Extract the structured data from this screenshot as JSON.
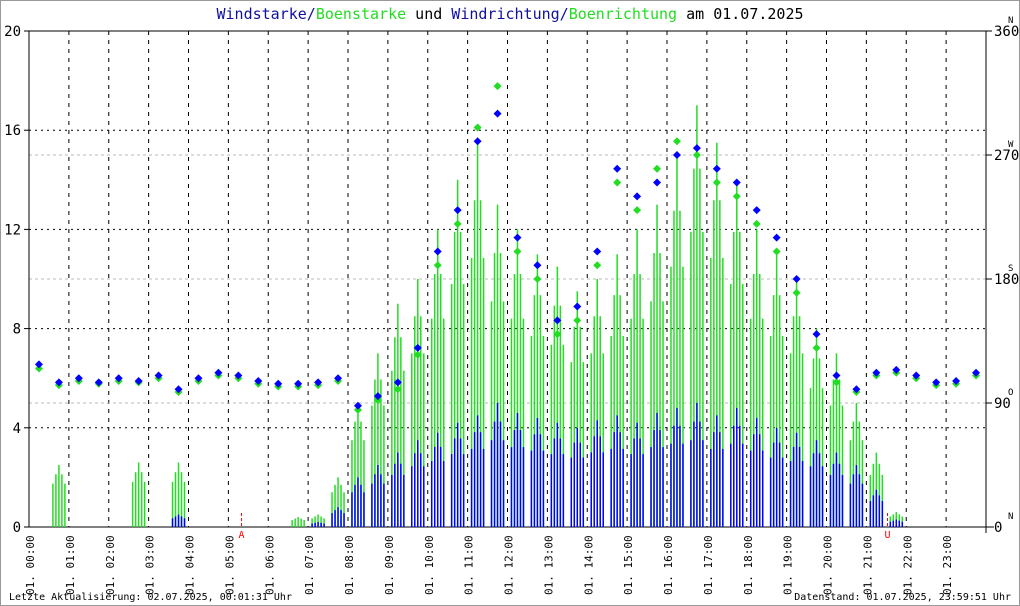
{
  "chart_data": {
    "type": "scatter",
    "title_parts": [
      {
        "text": "Windstarke",
        "color": "#1010a0"
      },
      {
        "text": "/",
        "color": "#1010a0"
      },
      {
        "text": "Boenstarke",
        "color": "#22dd22"
      },
      {
        "text": " und ",
        "color": "#000000"
      },
      {
        "text": "Windrichtung",
        "color": "#1010a0"
      },
      {
        "text": "/",
        "color": "#1010a0"
      },
      {
        "text": "Boenrichtung",
        "color": "#22dd22"
      },
      {
        "text": " am 01.07.2025",
        "color": "#000000"
      }
    ],
    "y_left": {
      "range": [
        0,
        20
      ],
      "ticks": [
        0,
        4,
        8,
        12,
        16,
        20
      ]
    },
    "y_right": {
      "range": [
        0,
        360
      ],
      "ticks": [
        0,
        90,
        180,
        270,
        360
      ],
      "compass": [
        "N",
        "O",
        "S",
        "W",
        "N"
      ]
    },
    "x_labels": [
      "01. 00:00",
      "01. 01:00",
      "01. 02:00",
      "01. 03:00",
      "01. 04:00",
      "01. 05:00",
      "01. 06:00",
      "01. 07:00",
      "01. 08:00",
      "01. 09:00",
      "01. 10:00",
      "01. 11:00",
      "01. 12:00",
      "01. 13:00",
      "01. 14:00",
      "01. 15:00",
      "01. 16:00",
      "01. 17:00",
      "01. 18:00",
      "01. 19:00",
      "01. 20:00",
      "01. 21:00",
      "01. 22:00",
      "01. 23:00"
    ],
    "markers": [
      {
        "label": "A",
        "hour": 5.33,
        "color": "#ff0000"
      },
      {
        "label": "U",
        "hour": 21.53,
        "color": "#ff0000"
      }
    ],
    "x_hours_step": 0.5,
    "series": [
      {
        "name": "Windstarke",
        "color": "#0000ff",
        "kind": "bar",
        "values": [
          0,
          0,
          0,
          0,
          0,
          0,
          0,
          0.5,
          0,
          0,
          0,
          0,
          0,
          0,
          0.2,
          0.8,
          2,
          2.5,
          3,
          3.5,
          3.8,
          4.2,
          4.5,
          5,
          4.6,
          4.4,
          4.2,
          4,
          4.3,
          4.5,
          4.2,
          4.6,
          4.8,
          5,
          4.5,
          4.8,
          4.4,
          4,
          3.8,
          3.5,
          3,
          2.5,
          1.5,
          0.3,
          0,
          0,
          0,
          0
        ]
      },
      {
        "name": "Boenstarke",
        "color": "#22dd22",
        "kind": "bar",
        "values": [
          0,
          2.5,
          0,
          0,
          0,
          2.6,
          0,
          2.6,
          0,
          0,
          0,
          0,
          0,
          0.4,
          0.5,
          2,
          5,
          7,
          9,
          10,
          12,
          14,
          15.5,
          13,
          12,
          11,
          10.5,
          9.5,
          10,
          11,
          12,
          13,
          15,
          17,
          15.5,
          14,
          12,
          11,
          10,
          8,
          7,
          5,
          3,
          0.6,
          0,
          0,
          0,
          0
        ]
      },
      {
        "name": "Windrichtung",
        "color": "#0000ff",
        "kind": "diamond",
        "values": [
          118,
          105,
          108,
          105,
          108,
          106,
          110,
          100,
          108,
          112,
          110,
          106,
          104,
          104,
          105,
          108,
          88,
          95,
          105,
          130,
          200,
          230,
          280,
          300,
          210,
          190,
          150,
          160,
          200,
          260,
          240,
          250,
          270,
          275,
          260,
          250,
          230,
          210,
          180,
          140,
          110,
          100,
          112,
          114,
          110,
          105,
          106,
          112
        ]
      },
      {
        "name": "Boenrichtung",
        "color": "#22dd22",
        "kind": "diamond",
        "values": [
          115,
          103,
          106,
          104,
          106,
          105,
          108,
          98,
          106,
          110,
          108,
          104,
          102,
          102,
          103,
          106,
          85,
          92,
          100,
          125,
          190,
          220,
          290,
          320,
          200,
          180,
          140,
          150,
          190,
          250,
          230,
          260,
          280,
          270,
          250,
          240,
          220,
          200,
          170,
          130,
          105,
          98,
          110,
          112,
          108,
          103,
          104,
          110
        ]
      }
    ]
  },
  "footer": {
    "left": "Letzte Aktualisierung: 02.07.2025, 00:01:31 Uhr",
    "right": "Datenstand: 01.07.2025, 23:59:51 Uhr"
  }
}
